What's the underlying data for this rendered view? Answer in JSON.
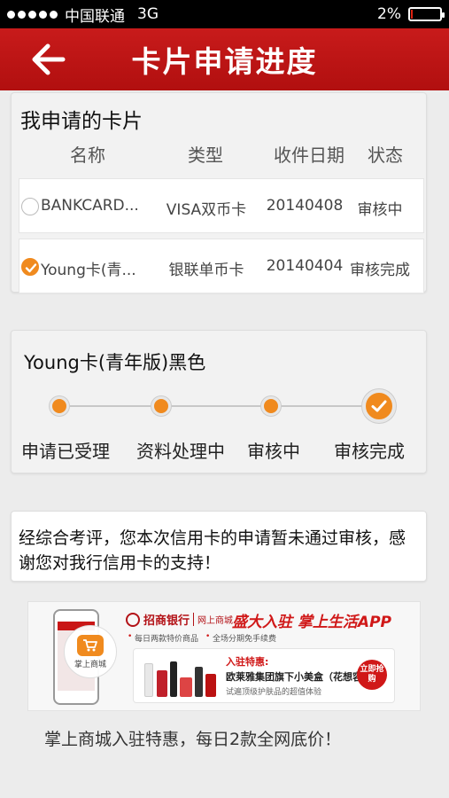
{
  "status_bar": {
    "carrier": "中国联通",
    "network": "3G",
    "battery_percent": "2%",
    "battery_level": 0.02
  },
  "nav": {
    "title": "卡片申请进度"
  },
  "applications": {
    "title": "我申请的卡片",
    "columns": [
      "名称",
      "类型",
      "收件日期",
      "状态"
    ],
    "rows": [
      {
        "name": "BANKCARD...",
        "type": "VISA双币卡",
        "date": "20140408",
        "status": "审核中",
        "selected": false
      },
      {
        "name": "Young卡(青...",
        "type": "银联单币卡",
        "date": "20140404",
        "status": "审核完成",
        "selected": true
      }
    ]
  },
  "progress": {
    "title": "Young卡(青年版)黑色",
    "steps": [
      "申请已受理",
      "资料处理中",
      "审核中",
      "审核完成"
    ],
    "current_step": 4
  },
  "result": {
    "message": "经综合考评，您本次信用卡的申请暂未通过审核，感谢您对我行信用卡的支持！"
  },
  "banner": {
    "mall_label": "掌上商城",
    "bank_name": "招商银行",
    "bank_sub": "网上商城",
    "headline": "盛大入驻 掌上生活APP",
    "bullets": [
      "每日两款特价商品",
      "全场分期免手续费"
    ],
    "offer_title": "入驻特惠:",
    "offer_line": "欧莱雅集团旗下小美盒（花想容）",
    "offer_desc": "试遍顶级护肤品的超值体验",
    "buy_label": "立即抢购"
  },
  "caption": "掌上商城入驻特惠，每日2款全网底价！",
  "colors": {
    "nav_red": "#b81414",
    "accent_orange": "#f08a1e"
  }
}
